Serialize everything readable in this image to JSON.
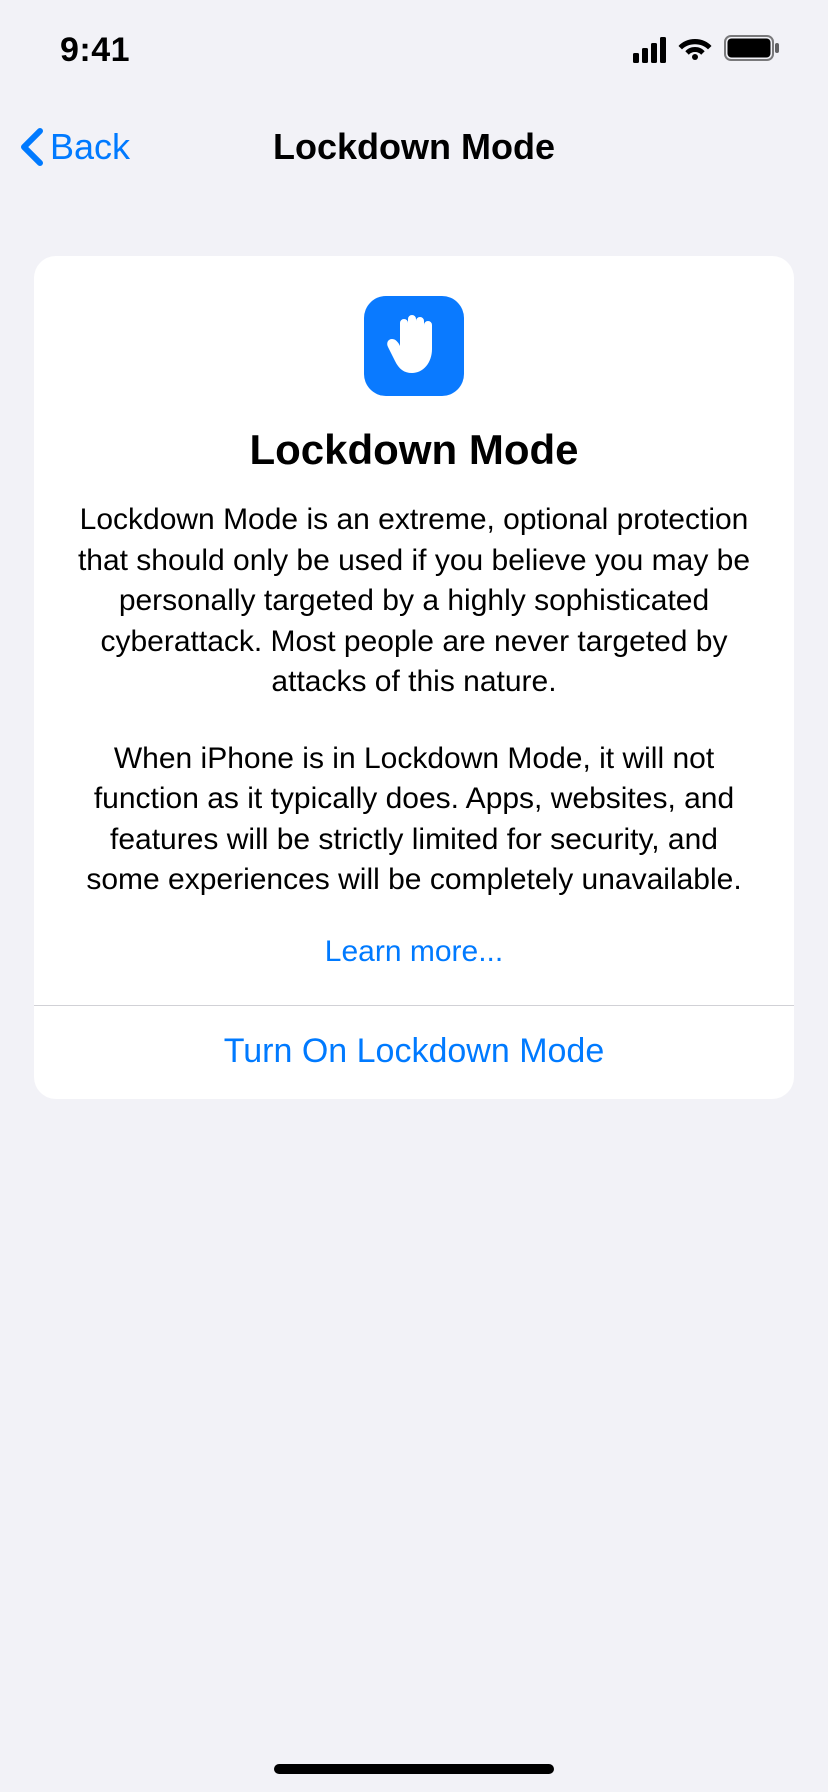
{
  "status": {
    "time": "9:41"
  },
  "nav": {
    "back_label": "Back",
    "title": "Lockdown Mode"
  },
  "card": {
    "title": "Lockdown Mode",
    "p1": "Lockdown Mode is an extreme, optional protection that should only be used if you believe you may be personally targeted by a highly sophisticated cyberattack. Most people are never targeted by attacks of this nature.",
    "p2": "When iPhone is in Lockdown Mode, it will not function as it typically does. Apps, websites, and features will be strictly limited for security, and some experiences will be completely unavailable.",
    "learn_more": "Learn more...",
    "turn_on": "Turn On Lockdown Mode"
  }
}
